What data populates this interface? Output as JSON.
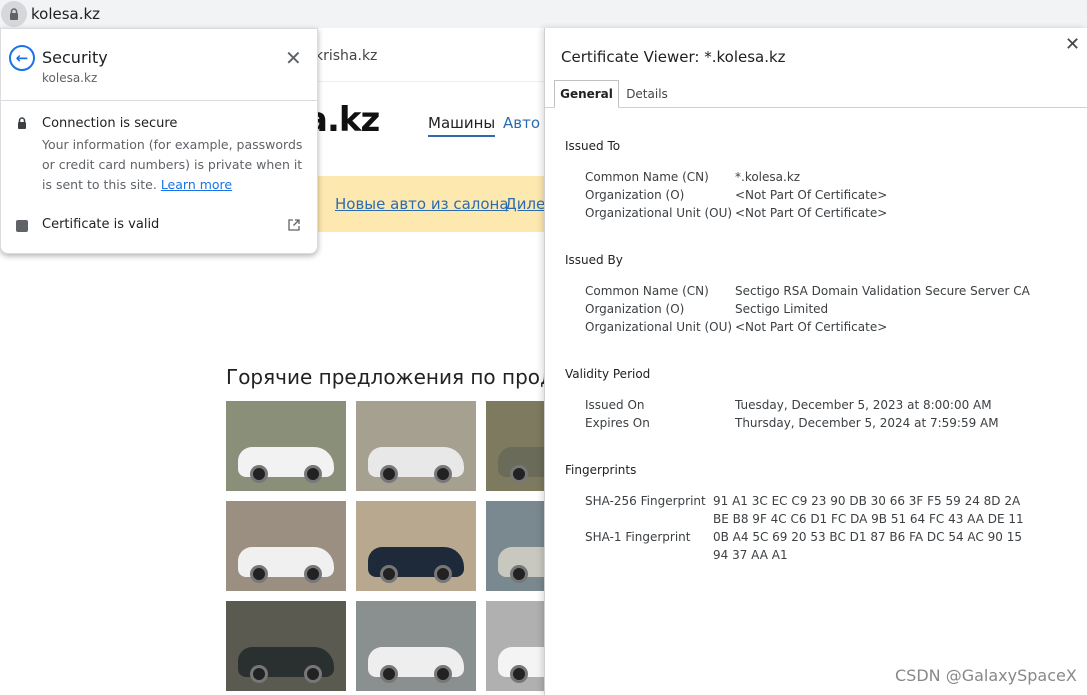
{
  "address_bar": {
    "url": "kolesa.kz"
  },
  "page": {
    "site_link": "krisha.kz",
    "logo_text": "a.kz",
    "nav": [
      "Машины",
      "Авто с"
    ],
    "banner_links": [
      "Новые авто из салона",
      "Дилер"
    ],
    "hot_offers_title": "Горячие предложения по продаж",
    "thumb_colors": [
      "#f2f2f2",
      "#e8e8e8",
      "#6b6b5a",
      "#f0f0f0",
      "#1e2a3a",
      "#c8c8c0",
      "#2a3030",
      "#eeeeee",
      "#f4f4f4"
    ],
    "thumb_bgs": [
      "#8a8f7a",
      "#a5a090",
      "#7e7a60",
      "#9a8f80",
      "#b8a890",
      "#7a8890",
      "#5a5a50",
      "#8a9090",
      "#b0b0b0"
    ]
  },
  "security_popup": {
    "title": "Security",
    "domain": "kolesa.kz",
    "connection_title": "Connection is secure",
    "connection_text": "Your information (for example, passwords or credit card numbers) is private when it is sent to this site.",
    "learn_more": "Learn more",
    "certificate_label": "Certificate is valid"
  },
  "cert_viewer": {
    "title": "Certificate Viewer: *.kolesa.kz",
    "tabs": {
      "general": "General",
      "details": "Details"
    },
    "issued_to": {
      "heading": "Issued To",
      "rows": [
        {
          "label": "Common Name (CN)",
          "value": "*.kolesa.kz"
        },
        {
          "label": "Organization (O)",
          "value": "<Not Part Of Certificate>"
        },
        {
          "label": "Organizational Unit (OU)",
          "value": "<Not Part Of Certificate>"
        }
      ]
    },
    "issued_by": {
      "heading": "Issued By",
      "rows": [
        {
          "label": "Common Name (CN)",
          "value": "Sectigo RSA Domain Validation Secure Server CA"
        },
        {
          "label": "Organization (O)",
          "value": "Sectigo Limited"
        },
        {
          "label": "Organizational Unit (OU)",
          "value": "<Not Part Of Certificate>"
        }
      ]
    },
    "validity": {
      "heading": "Validity Period",
      "rows": [
        {
          "label": "Issued On",
          "value": "Tuesday, December 5, 2023 at 8:00:00 AM"
        },
        {
          "label": "Expires On",
          "value": "Thursday, December 5, 2024 at 7:59:59 AM"
        }
      ]
    },
    "fingerprints": {
      "heading": "Fingerprints",
      "sha256_label": "SHA-256 Fingerprint",
      "sha256_line1": "91 A1 3C EC C9 23 90 DB 30 66 3F F5 59 24 8D 2A",
      "sha256_line2": "BE B8 9F 4C C6 D1 FC DA 9B 51 64 FC 43 AA DE 11",
      "sha1_label": "SHA-1 Fingerprint",
      "sha1_line1": "0B A4 5C 69 20 53 BC D1 87 B6 FA DC 54 AC 90 15",
      "sha1_line2": "94 37 AA A1"
    }
  },
  "watermark": "CSDN @GalaxySpaceX"
}
